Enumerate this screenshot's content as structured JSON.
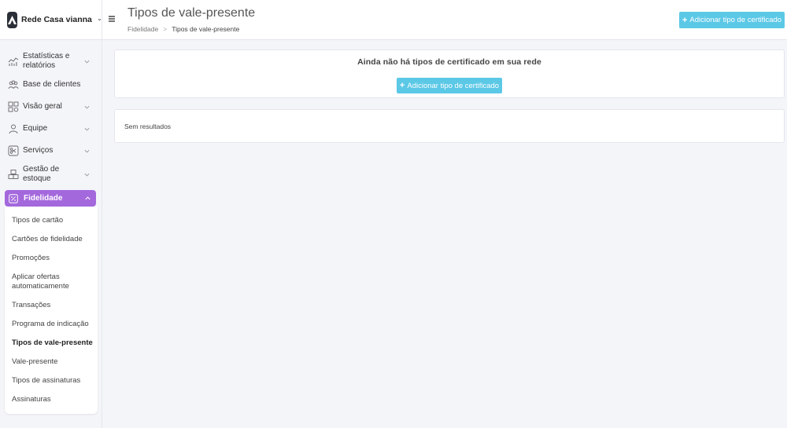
{
  "brand": {
    "name": "Rede Casa vianna",
    "icon": "brand-logo-icon"
  },
  "sidebar": {
    "items": [
      {
        "label": "Estatísticas e relatórios",
        "icon": "chart-icon",
        "expandable": true
      },
      {
        "label": "Base de clientes",
        "icon": "users-icon",
        "expandable": false
      },
      {
        "label": "Visão geral",
        "icon": "grid-icon",
        "expandable": true
      },
      {
        "label": "Equipe",
        "icon": "user-icon",
        "expandable": true
      },
      {
        "label": "Serviços",
        "icon": "scissors-icon",
        "expandable": true
      },
      {
        "label": "Gestão de estoque",
        "icon": "boxes-icon",
        "expandable": true
      }
    ],
    "active": {
      "label": "Fidelidade",
      "icon": "percent-icon",
      "color": "#a468dd"
    },
    "submenu": [
      {
        "label": "Tipos de cartão"
      },
      {
        "label": "Cartões de fidelidade"
      },
      {
        "label": "Promoções"
      },
      {
        "label": "Aplicar ofertas automaticamente"
      },
      {
        "label": "Transações"
      },
      {
        "label": "Programa de indicação"
      },
      {
        "label": "Tipos de vale-presente",
        "current": true
      },
      {
        "label": "Vale-presente"
      },
      {
        "label": "Tipos de assinaturas"
      },
      {
        "label": "Assinaturas"
      }
    ]
  },
  "header": {
    "title": "Tipos de vale-presente",
    "breadcrumb": [
      "Fidelidade",
      "Tipos de vale-presente"
    ],
    "add_button": "Adicionar tipo de certificado",
    "accent": "#5bc8e6"
  },
  "main": {
    "empty_title": "Ainda não há tipos de certificado em sua rede",
    "empty_button": "Adicionar tipo de certificado",
    "no_results": "Sem resultados"
  }
}
